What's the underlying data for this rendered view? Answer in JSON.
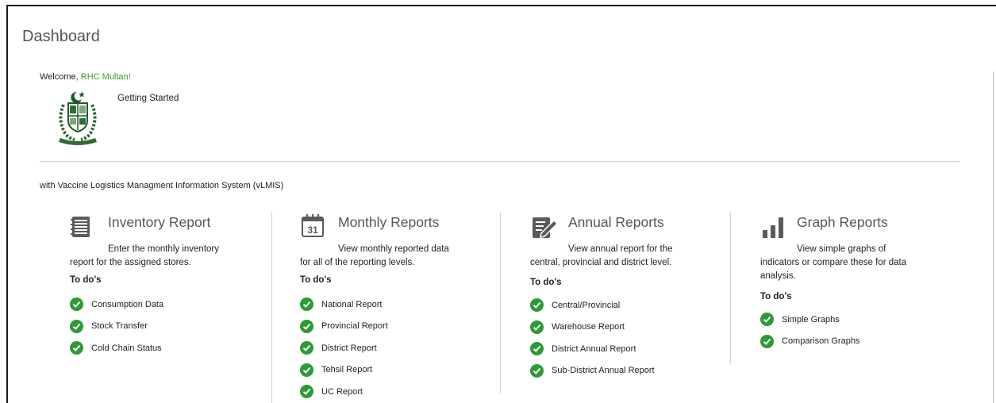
{
  "page": {
    "title": "Dashboard",
    "welcome_prefix": "Welcome, ",
    "welcome_user": "RHC Multan!",
    "getting_started": "Getting Started",
    "with_text": "with Vaccine Logistics Managment Information System (vLMIS)"
  },
  "colors": {
    "accent_green": "#2c9a35",
    "user_green": "#3c9a2f",
    "heading_gray": "#555555"
  },
  "sections": [
    {
      "icon": "notebook-icon",
      "title": "Inventory Report",
      "desc_line1": "Enter the monthly inventory",
      "desc_line2": "report for the assigned stores.",
      "todo_title": "To do's",
      "items": [
        "Consumption Data",
        "Stock Transfer",
        "Cold Chain Status"
      ]
    },
    {
      "icon": "calendar-icon",
      "icon_text": "31",
      "title": "Monthly Reports",
      "desc_line1": "View monthly reported data",
      "desc_line2": "for all of the reporting levels.",
      "todo_title": "To do's",
      "items": [
        "National Report",
        "Provincial Report",
        "District Report",
        "Tehsil Report",
        "UC Report"
      ]
    },
    {
      "icon": "edit-document-icon",
      "title": "Annual Reports",
      "desc_line1": "View annual report for the",
      "desc_line2": "central, provincial and district level.",
      "todo_title": "To do's",
      "items": [
        "Central/Provincial",
        "Warehouse Report",
        "District Annual Report",
        "Sub-District Annual Report"
      ]
    },
    {
      "icon": "bar-chart-icon",
      "title": "Graph Reports",
      "desc_line1": "View simple graphs of",
      "desc_line2": "indicators or compare these for data",
      "desc_line3": "analysis.",
      "todo_title": "To do's",
      "items": [
        "Simple Graphs",
        "Comparison Graphs"
      ]
    }
  ]
}
